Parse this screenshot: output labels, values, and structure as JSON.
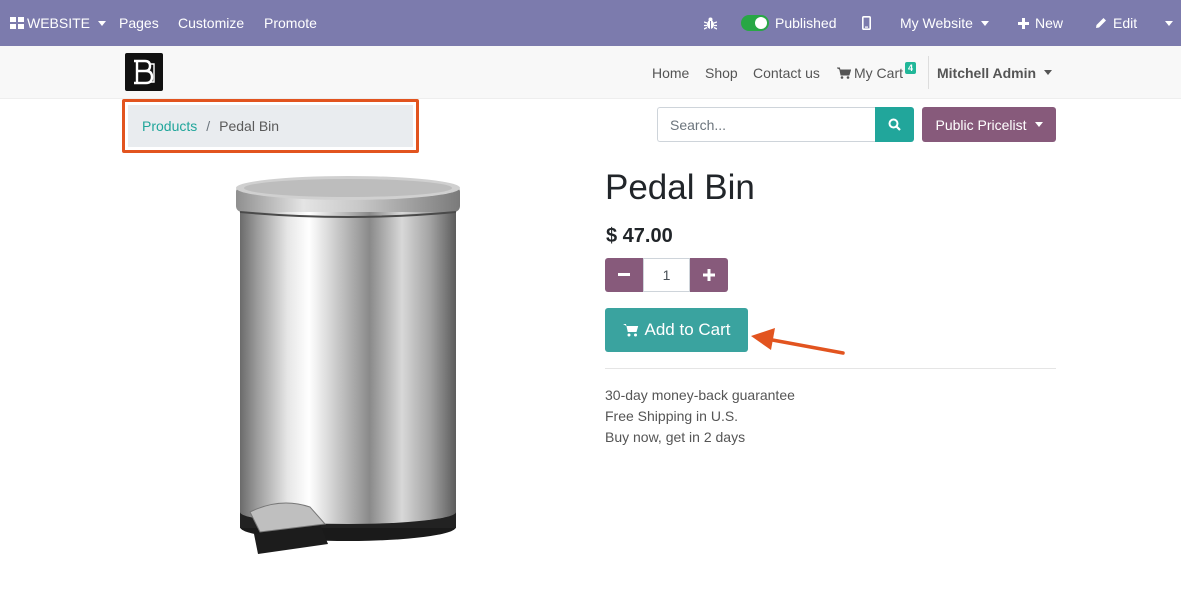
{
  "topbar": {
    "website_label": "WEBSITE",
    "menu": [
      "Pages",
      "Customize",
      "Promote"
    ],
    "published_label": "Published",
    "my_website_label": "My Website",
    "new_label": "New",
    "edit_label": "Edit"
  },
  "header": {
    "logo_text": "B",
    "nav": [
      "Home",
      "Shop",
      "Contact us"
    ],
    "cart_label": "My Cart",
    "cart_count": "4",
    "user_label": "Mitchell Admin"
  },
  "breadcrumb": {
    "parent": "Products",
    "separator": "/",
    "current": "Pedal Bin"
  },
  "search": {
    "placeholder": "Search..."
  },
  "pricelist_label": "Public Pricelist",
  "product": {
    "title": "Pedal Bin",
    "price": "$ 47.00",
    "quantity": "1",
    "add_to_cart_label": "Add to Cart",
    "info": [
      "30-day money-back guarantee",
      "Free Shipping in U.S.",
      "Buy now, get in 2 days"
    ]
  },
  "colors": {
    "topbar": "#7c7bad",
    "teal": "#21a69b",
    "purple": "#875a7b",
    "highlight": "#e2541f"
  },
  "icons": {
    "apps": "apps-grid-icon",
    "debug": "bug-icon",
    "mobile": "mobile-icon",
    "new": "plus-icon",
    "edit": "pencil-icon",
    "cart": "cart-icon",
    "search": "search-icon"
  }
}
